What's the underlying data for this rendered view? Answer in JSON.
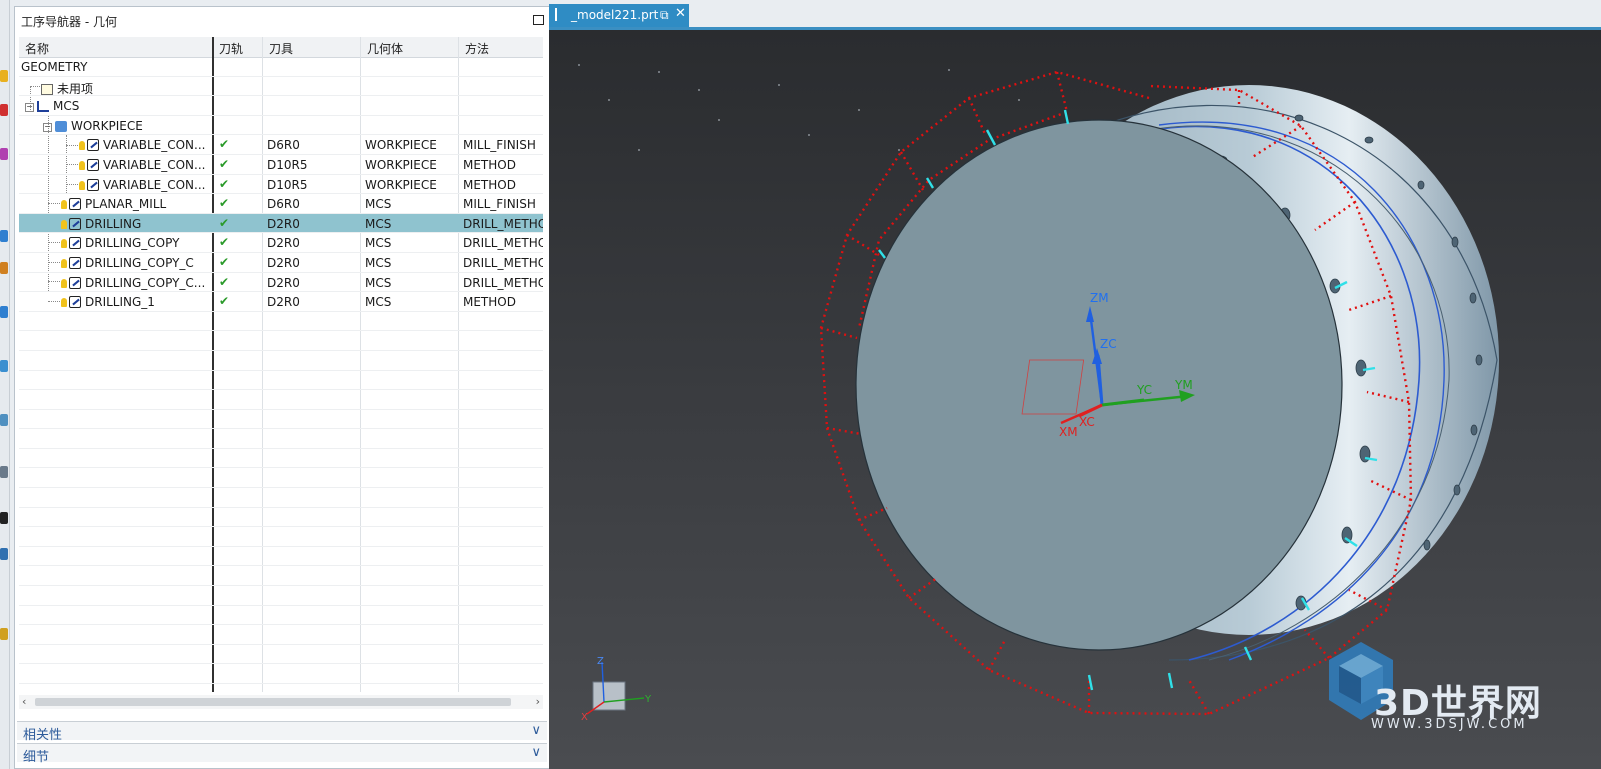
{
  "navigator": {
    "title": "工序导航器 - 几何",
    "columns": [
      "名称",
      "刀轨",
      "刀具",
      "几何体",
      "方法"
    ],
    "rows": [
      {
        "name": "GEOMETRY",
        "path": "",
        "tool": "",
        "geometry": "",
        "method": "",
        "kind": "root"
      },
      {
        "name": "未用项",
        "path": "",
        "tool": "",
        "geometry": "",
        "method": "",
        "kind": "unused"
      },
      {
        "name": "MCS",
        "path": "",
        "tool": "",
        "geometry": "",
        "method": "",
        "kind": "mcs"
      },
      {
        "name": "WORKPIECE",
        "path": "",
        "tool": "",
        "geometry": "",
        "method": "",
        "kind": "workpiece"
      },
      {
        "name": "VARIABLE_CON...",
        "path": "✔",
        "tool": "D6R0",
        "geometry": "WORKPIECE",
        "method": "MILL_FINISH",
        "kind": "op3"
      },
      {
        "name": "VARIABLE_CON...",
        "path": "✔",
        "tool": "D10R5",
        "geometry": "WORKPIECE",
        "method": "METHOD",
        "kind": "op3"
      },
      {
        "name": "VARIABLE_CON...",
        "path": "✔",
        "tool": "D10R5",
        "geometry": "WORKPIECE",
        "method": "METHOD",
        "kind": "op3"
      },
      {
        "name": "PLANAR_MILL",
        "path": "✔",
        "tool": "D6R0",
        "geometry": "MCS",
        "method": "MILL_FINISH",
        "kind": "op2"
      },
      {
        "name": "DRILLING",
        "path": "✔",
        "tool": "D2R0",
        "geometry": "MCS",
        "method": "DRILL_METHO",
        "kind": "op2",
        "selected": true
      },
      {
        "name": "DRILLING_COPY",
        "path": "✔",
        "tool": "D2R0",
        "geometry": "MCS",
        "method": "DRILL_METHO",
        "kind": "op2"
      },
      {
        "name": "DRILLING_COPY_C",
        "path": "✔",
        "tool": "D2R0",
        "geometry": "MCS",
        "method": "DRILL_METHO",
        "kind": "op2"
      },
      {
        "name": "DRILLING_COPY_C...",
        "path": "✔",
        "tool": "D2R0",
        "geometry": "MCS",
        "method": "DRILL_METHO",
        "kind": "op2"
      },
      {
        "name": "DRILLING_1",
        "path": "✔",
        "tool": "D2R0",
        "geometry": "MCS",
        "method": "METHOD",
        "kind": "op2"
      }
    ],
    "sections": [
      "相关性",
      "细节"
    ]
  },
  "viewport": {
    "tab_label": "_model221.prt",
    "axis_labels": {
      "zm": "ZM",
      "zc": "ZC",
      "yc": "YC",
      "ym": "YM",
      "xm": "XM",
      "xc": "XC"
    },
    "mini_triad": {
      "z": "Z",
      "y": "Y",
      "x": "X"
    },
    "watermark_text": "3D世界网",
    "watermark_url": "WWW.3DSJW.COM"
  },
  "colors": {
    "selection": "#8fc3cf",
    "tab": "#2f8cc4",
    "path_red": "#e01010",
    "cyan": "#30e0e8"
  }
}
